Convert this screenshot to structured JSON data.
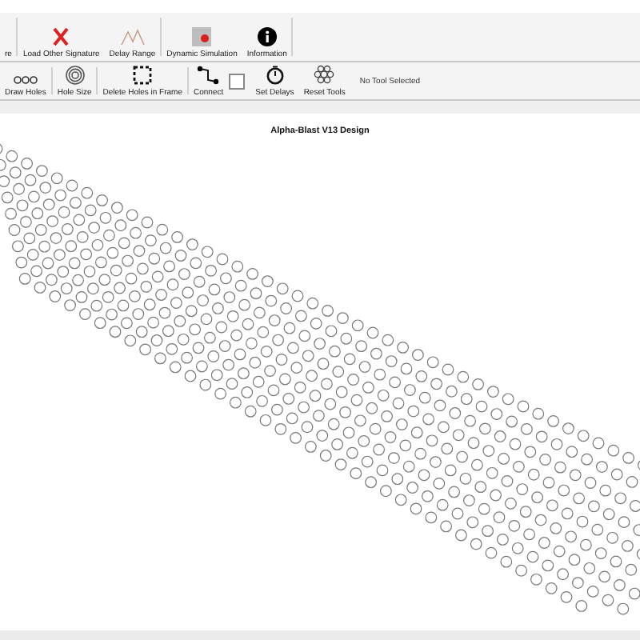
{
  "toolbar_top": [
    {
      "kind": "none",
      "label": "re"
    },
    {
      "kind": "cross",
      "label": "Load Other Signature"
    },
    {
      "kind": "range",
      "label": "Delay Range"
    },
    {
      "kind": "sim",
      "label": "Dynamic Simulation"
    },
    {
      "kind": "info",
      "label": "Information"
    }
  ],
  "toolbar_bottom": [
    {
      "kind": "dots",
      "label": "Draw Holes"
    },
    {
      "kind": "rings",
      "label": "Hole Size"
    },
    {
      "kind": "frame",
      "label": "Delete Holes in Frame"
    },
    {
      "kind": "connect",
      "label": "Connect"
    },
    {
      "kind": "checkbox",
      "checked": false
    },
    {
      "kind": "timer",
      "label": "Set Delays"
    },
    {
      "kind": "gear",
      "label": "Reset Tools"
    }
  ],
  "tool_status": "No Tool Selected",
  "design_title": "Alpha-Blast V13 Design"
}
